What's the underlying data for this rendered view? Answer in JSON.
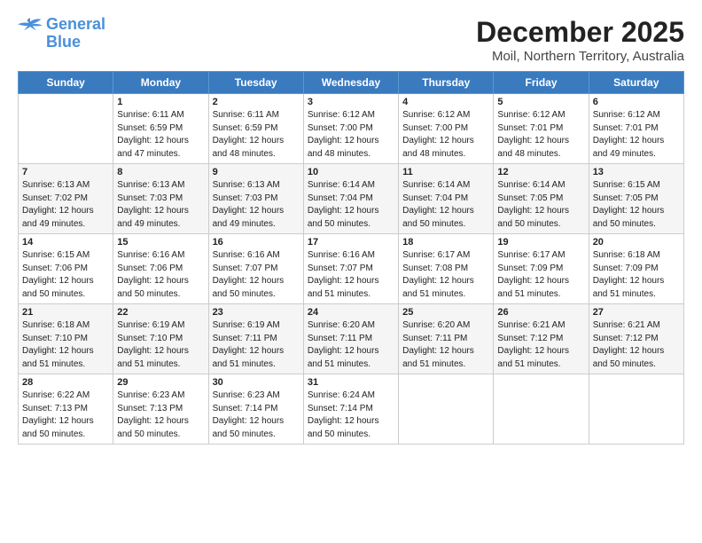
{
  "logo": {
    "line1": "General",
    "line2": "Blue"
  },
  "title": "December 2025",
  "subtitle": "Moil, Northern Territory, Australia",
  "days_header": [
    "Sunday",
    "Monday",
    "Tuesday",
    "Wednesday",
    "Thursday",
    "Friday",
    "Saturday"
  ],
  "weeks": [
    [
      {
        "day": "",
        "info": ""
      },
      {
        "day": "1",
        "info": "Sunrise: 6:11 AM\nSunset: 6:59 PM\nDaylight: 12 hours\nand 47 minutes."
      },
      {
        "day": "2",
        "info": "Sunrise: 6:11 AM\nSunset: 6:59 PM\nDaylight: 12 hours\nand 48 minutes."
      },
      {
        "day": "3",
        "info": "Sunrise: 6:12 AM\nSunset: 7:00 PM\nDaylight: 12 hours\nand 48 minutes."
      },
      {
        "day": "4",
        "info": "Sunrise: 6:12 AM\nSunset: 7:00 PM\nDaylight: 12 hours\nand 48 minutes."
      },
      {
        "day": "5",
        "info": "Sunrise: 6:12 AM\nSunset: 7:01 PM\nDaylight: 12 hours\nand 48 minutes."
      },
      {
        "day": "6",
        "info": "Sunrise: 6:12 AM\nSunset: 7:01 PM\nDaylight: 12 hours\nand 49 minutes."
      }
    ],
    [
      {
        "day": "7",
        "info": "Sunrise: 6:13 AM\nSunset: 7:02 PM\nDaylight: 12 hours\nand 49 minutes."
      },
      {
        "day": "8",
        "info": "Sunrise: 6:13 AM\nSunset: 7:03 PM\nDaylight: 12 hours\nand 49 minutes."
      },
      {
        "day": "9",
        "info": "Sunrise: 6:13 AM\nSunset: 7:03 PM\nDaylight: 12 hours\nand 49 minutes."
      },
      {
        "day": "10",
        "info": "Sunrise: 6:14 AM\nSunset: 7:04 PM\nDaylight: 12 hours\nand 50 minutes."
      },
      {
        "day": "11",
        "info": "Sunrise: 6:14 AM\nSunset: 7:04 PM\nDaylight: 12 hours\nand 50 minutes."
      },
      {
        "day": "12",
        "info": "Sunrise: 6:14 AM\nSunset: 7:05 PM\nDaylight: 12 hours\nand 50 minutes."
      },
      {
        "day": "13",
        "info": "Sunrise: 6:15 AM\nSunset: 7:05 PM\nDaylight: 12 hours\nand 50 minutes."
      }
    ],
    [
      {
        "day": "14",
        "info": "Sunrise: 6:15 AM\nSunset: 7:06 PM\nDaylight: 12 hours\nand 50 minutes."
      },
      {
        "day": "15",
        "info": "Sunrise: 6:16 AM\nSunset: 7:06 PM\nDaylight: 12 hours\nand 50 minutes."
      },
      {
        "day": "16",
        "info": "Sunrise: 6:16 AM\nSunset: 7:07 PM\nDaylight: 12 hours\nand 50 minutes."
      },
      {
        "day": "17",
        "info": "Sunrise: 6:16 AM\nSunset: 7:07 PM\nDaylight: 12 hours\nand 51 minutes."
      },
      {
        "day": "18",
        "info": "Sunrise: 6:17 AM\nSunset: 7:08 PM\nDaylight: 12 hours\nand 51 minutes."
      },
      {
        "day": "19",
        "info": "Sunrise: 6:17 AM\nSunset: 7:09 PM\nDaylight: 12 hours\nand 51 minutes."
      },
      {
        "day": "20",
        "info": "Sunrise: 6:18 AM\nSunset: 7:09 PM\nDaylight: 12 hours\nand 51 minutes."
      }
    ],
    [
      {
        "day": "21",
        "info": "Sunrise: 6:18 AM\nSunset: 7:10 PM\nDaylight: 12 hours\nand 51 minutes."
      },
      {
        "day": "22",
        "info": "Sunrise: 6:19 AM\nSunset: 7:10 PM\nDaylight: 12 hours\nand 51 minutes."
      },
      {
        "day": "23",
        "info": "Sunrise: 6:19 AM\nSunset: 7:11 PM\nDaylight: 12 hours\nand 51 minutes."
      },
      {
        "day": "24",
        "info": "Sunrise: 6:20 AM\nSunset: 7:11 PM\nDaylight: 12 hours\nand 51 minutes."
      },
      {
        "day": "25",
        "info": "Sunrise: 6:20 AM\nSunset: 7:11 PM\nDaylight: 12 hours\nand 51 minutes."
      },
      {
        "day": "26",
        "info": "Sunrise: 6:21 AM\nSunset: 7:12 PM\nDaylight: 12 hours\nand 51 minutes."
      },
      {
        "day": "27",
        "info": "Sunrise: 6:21 AM\nSunset: 7:12 PM\nDaylight: 12 hours\nand 50 minutes."
      }
    ],
    [
      {
        "day": "28",
        "info": "Sunrise: 6:22 AM\nSunset: 7:13 PM\nDaylight: 12 hours\nand 50 minutes."
      },
      {
        "day": "29",
        "info": "Sunrise: 6:23 AM\nSunset: 7:13 PM\nDaylight: 12 hours\nand 50 minutes."
      },
      {
        "day": "30",
        "info": "Sunrise: 6:23 AM\nSunset: 7:14 PM\nDaylight: 12 hours\nand 50 minutes."
      },
      {
        "day": "31",
        "info": "Sunrise: 6:24 AM\nSunset: 7:14 PM\nDaylight: 12 hours\nand 50 minutes."
      },
      {
        "day": "",
        "info": ""
      },
      {
        "day": "",
        "info": ""
      },
      {
        "day": "",
        "info": ""
      }
    ]
  ]
}
